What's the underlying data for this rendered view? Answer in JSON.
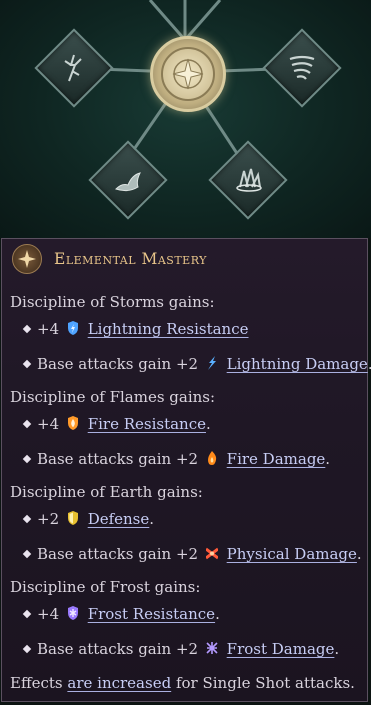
{
  "tree": {
    "nodes": [
      {
        "id": "storms-node",
        "icon": "lightning-tree-icon"
      },
      {
        "id": "center-node",
        "icon": "elemental-star-icon"
      },
      {
        "id": "wind-node",
        "icon": "whirlwind-icon"
      },
      {
        "id": "flames-node",
        "icon": "flame-icon"
      },
      {
        "id": "frost-node",
        "icon": "crystal-icon"
      }
    ]
  },
  "tooltip": {
    "title": "Elemental Mastery",
    "title_icon": "elemental-star-icon",
    "sections": [
      {
        "heading": "Discipline of Storms gains:",
        "lines": [
          {
            "prefix": "+4",
            "icon": "lightning-resistance-icon",
            "icon_color": "#4fa3ff",
            "link": "Lightning Resistance",
            "suffix": ""
          },
          {
            "prefix": "Base attacks gain +2",
            "icon": "lightning-damage-icon",
            "icon_color": "#5ab0ff",
            "link": "Lightning Damage",
            "suffix": "."
          }
        ]
      },
      {
        "heading": "Discipline of Flames gains:",
        "lines": [
          {
            "prefix": "+4",
            "icon": "fire-resistance-icon",
            "icon_color": "#ff9a2a",
            "link": "Fire Resistance",
            "suffix": "."
          },
          {
            "prefix": "Base attacks gain +2",
            "icon": "fire-damage-icon",
            "icon_color": "#ff8a1a",
            "link": "Fire Damage",
            "suffix": "."
          }
        ]
      },
      {
        "heading": "Discipline of Earth gains:",
        "lines": [
          {
            "prefix": "+2",
            "icon": "defense-icon",
            "icon_color": "#e8c030",
            "link": "Defense",
            "suffix": "."
          },
          {
            "prefix": "Base attacks gain +2",
            "icon": "physical-damage-icon",
            "icon_color": "#ff5a3a",
            "link": "Physical Damage",
            "suffix": "."
          }
        ]
      },
      {
        "heading": "Discipline of Frost gains:",
        "lines": [
          {
            "prefix": "+4",
            "icon": "frost-resistance-icon",
            "icon_color": "#9a7aff",
            "link": "Frost Resistance",
            "suffix": "."
          },
          {
            "prefix": "Base attacks gain +2",
            "icon": "frost-damage-icon",
            "icon_color": "#b49aff",
            "link": "Frost Damage",
            "suffix": "."
          }
        ]
      }
    ],
    "footer": {
      "prefix": "Effects ",
      "link": "are increased",
      "suffix": " for Single Shot attacks."
    }
  }
}
